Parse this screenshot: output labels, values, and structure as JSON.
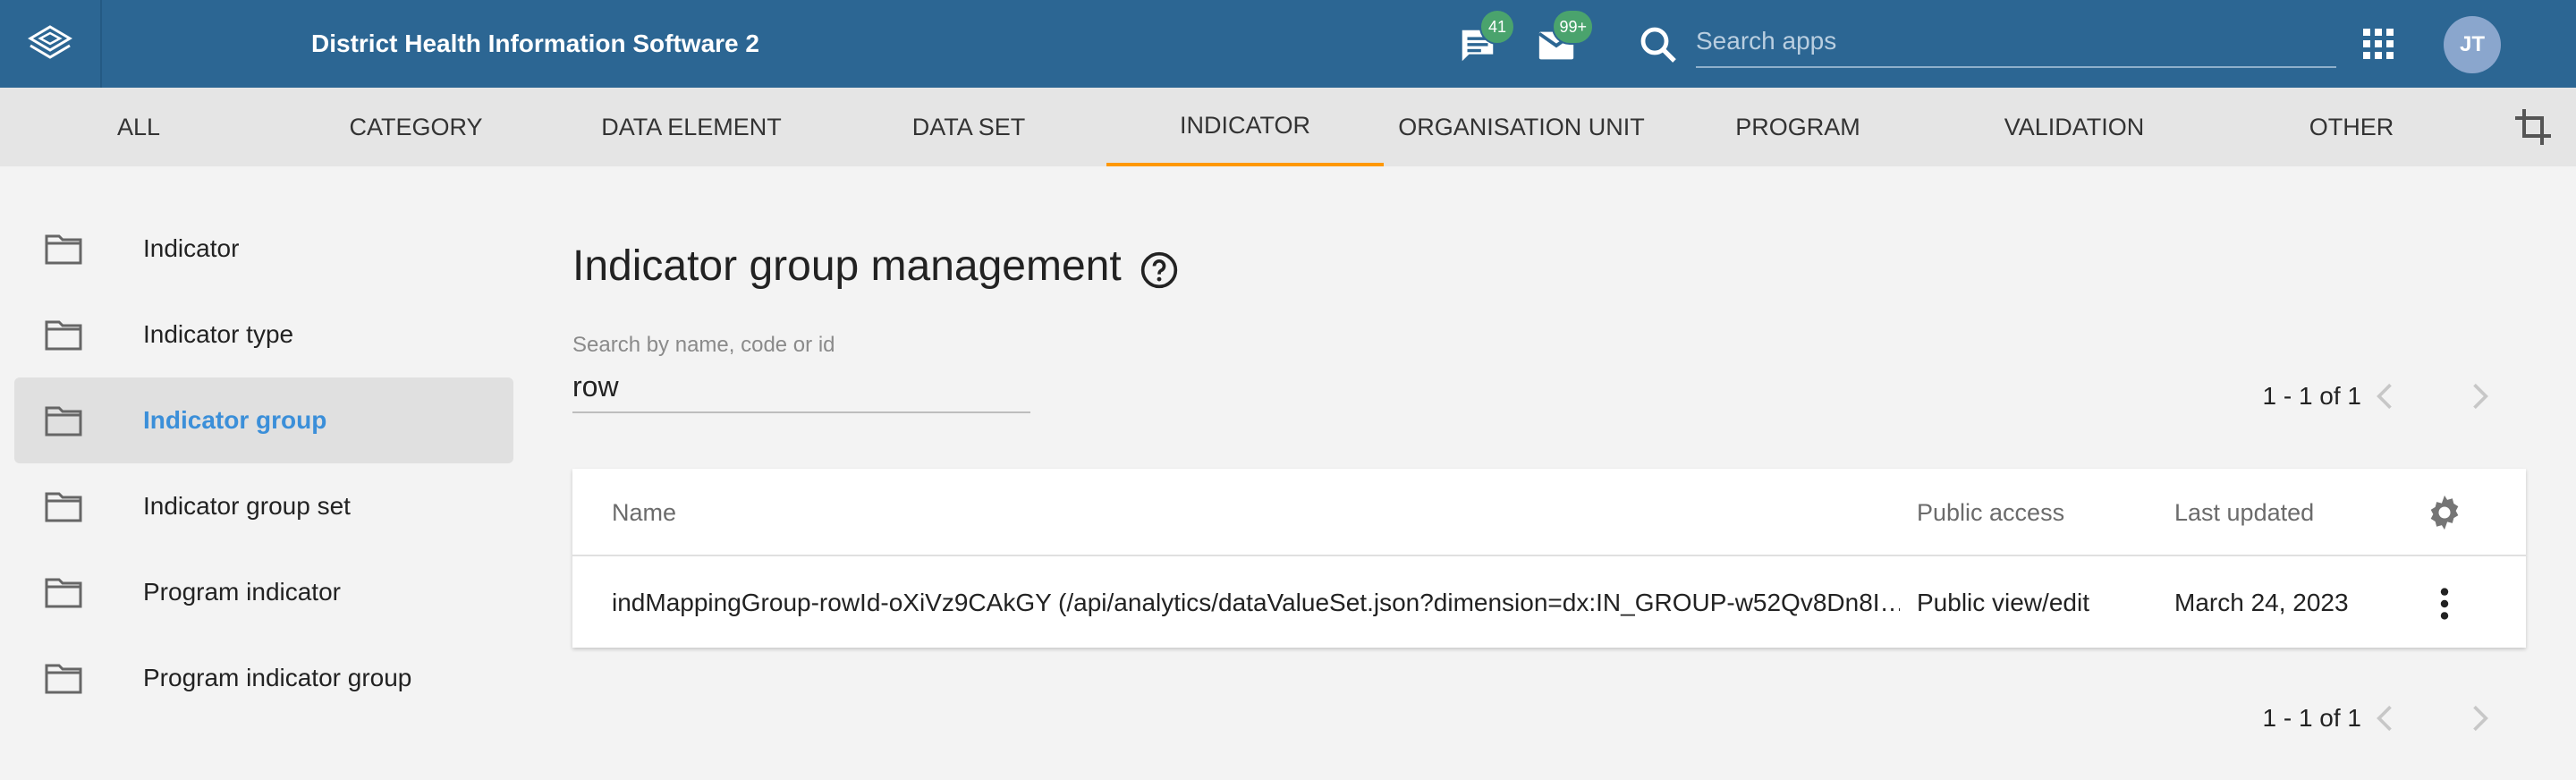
{
  "header": {
    "app_title": "District Health Information Software 2",
    "logo_icon": "dhis2-logo-icon",
    "messages_badge": "41",
    "interpretations_badge": "99+",
    "search_placeholder": "Search apps",
    "avatar_initials": "JT",
    "colors": {
      "bar": "#2c6693",
      "badge": "#4aa36d"
    }
  },
  "tabs": [
    {
      "label": "ALL"
    },
    {
      "label": "CATEGORY"
    },
    {
      "label": "DATA ELEMENT"
    },
    {
      "label": "DATA SET"
    },
    {
      "label": "INDICATOR",
      "active": true
    },
    {
      "label": "ORGANISATION UNIT"
    },
    {
      "label": "PROGRAM"
    },
    {
      "label": "VALIDATION"
    },
    {
      "label": "OTHER"
    }
  ],
  "sidebar": {
    "items": [
      {
        "label": "Indicator"
      },
      {
        "label": "Indicator type"
      },
      {
        "label": "Indicator group",
        "active": true
      },
      {
        "label": "Indicator group set"
      },
      {
        "label": "Program indicator"
      },
      {
        "label": "Program indicator group"
      }
    ]
  },
  "main": {
    "title": "Indicator group management",
    "search_label": "Search by name, code or id",
    "search_value": "row",
    "pager_top": "1 - 1 of 1",
    "pager_bottom": "1 - 1 of 1"
  },
  "table": {
    "columns": [
      "Name",
      "Public access",
      "Last updated"
    ],
    "rows": [
      {
        "name": "indMappingGroup-rowId-oXiVz9CAkGY (/api/analytics/dataValueSet.json?dimension=dx:IN_GROUP-w52Qv8Dn8I…",
        "public_access": "Public view/edit",
        "last_updated": "March 24, 2023"
      }
    ]
  },
  "accent": {
    "active_tab_underline": "#ff9800",
    "active_link": "#3b8fd9"
  }
}
